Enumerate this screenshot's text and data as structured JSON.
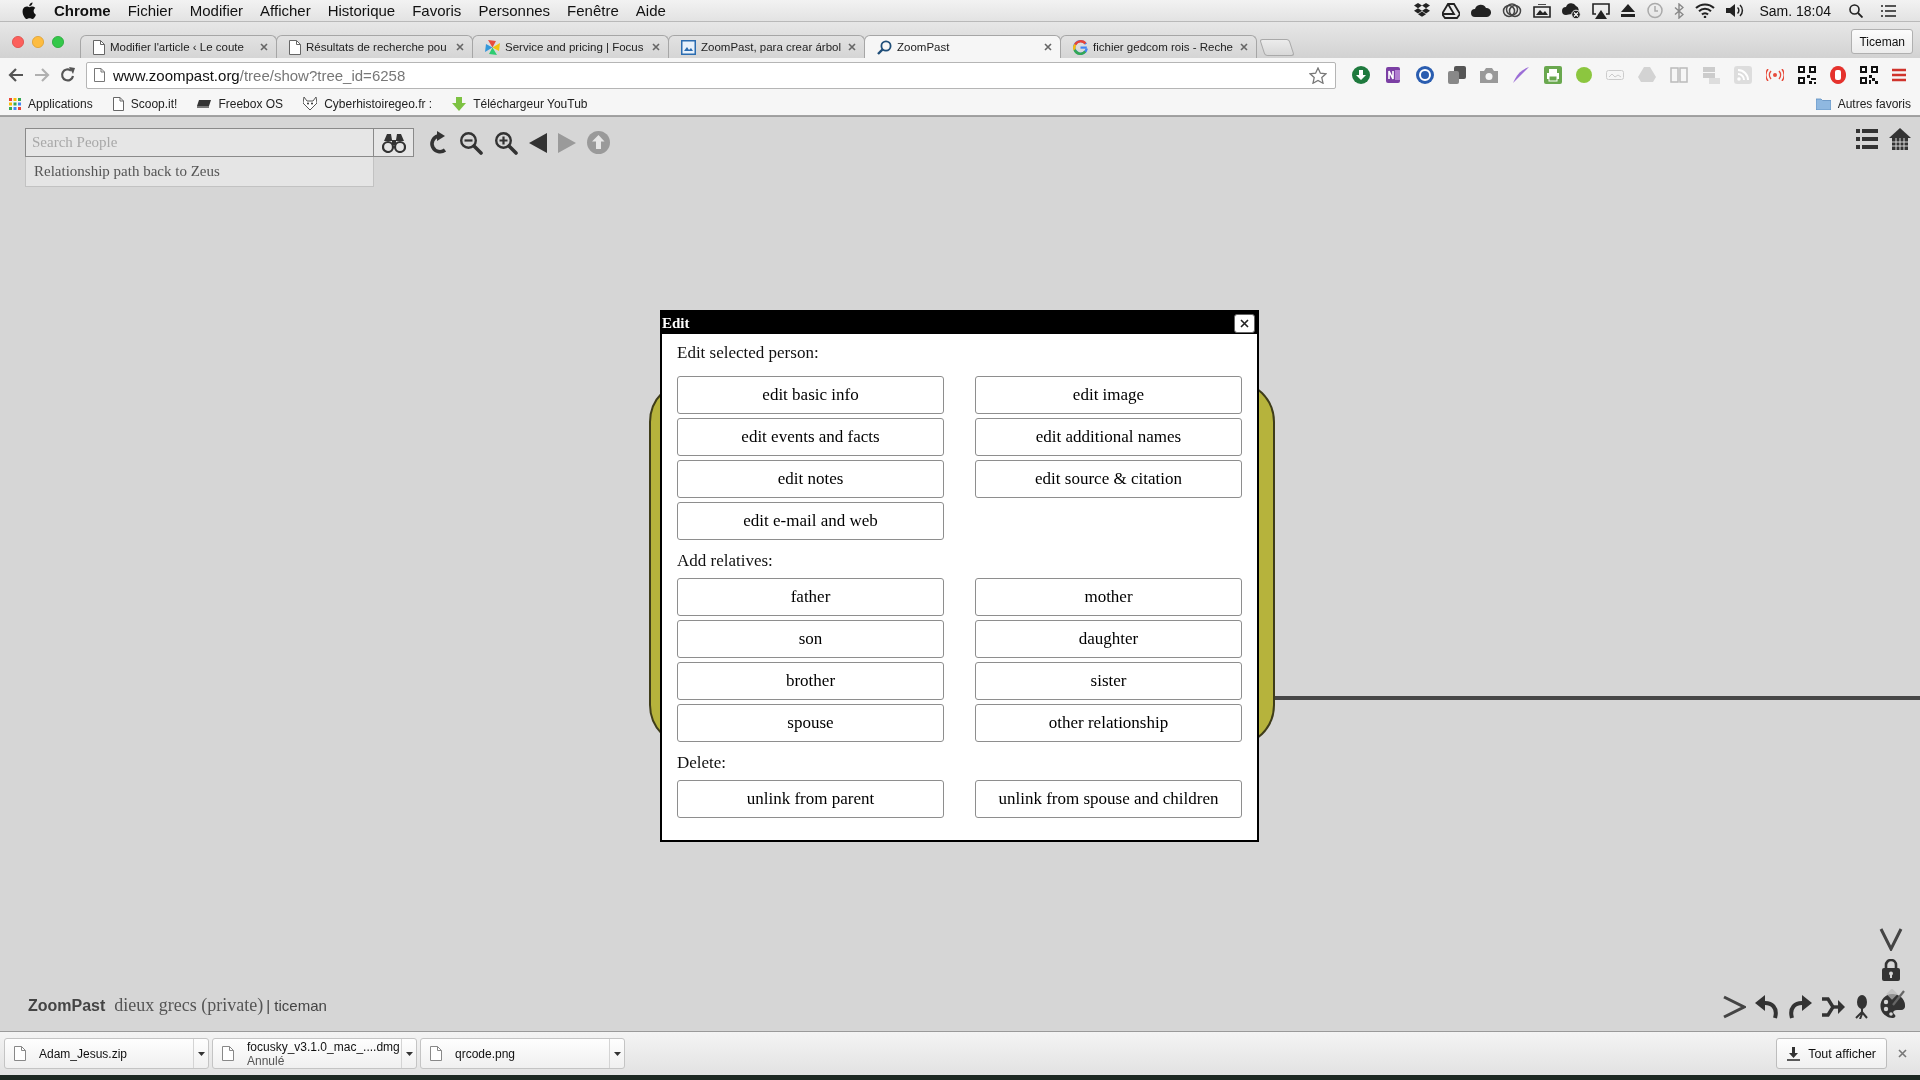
{
  "menu_bar": {
    "app": "Chrome",
    "menus": [
      "Fichier",
      "Modifier",
      "Afficher",
      "Historique",
      "Favoris",
      "Personnes",
      "Fenêtre",
      "Aide"
    ],
    "clock": "Sam. 18:04"
  },
  "browser": {
    "tabs": [
      {
        "title": "Modifier l'article ‹ Le coute",
        "kind": "page",
        "selected": false
      },
      {
        "title": "Résultats de recherche pou",
        "kind": "page",
        "selected": false
      },
      {
        "title": "Service and pricing | Focus",
        "kind": "pinwheel",
        "selected": false
      },
      {
        "title": "ZoomPast, para crear árbol",
        "kind": "picture",
        "selected": false
      },
      {
        "title": "ZoomPast",
        "kind": "magnifier",
        "selected": true
      },
      {
        "title": "fichier gedcom rois - Reche",
        "kind": "google",
        "selected": false
      }
    ],
    "profile": "Ticeman",
    "nav": [
      {
        "kind": "back",
        "disabled": false
      },
      {
        "kind": "forward",
        "disabled": true
      },
      {
        "kind": "reload",
        "disabled": false
      }
    ],
    "address": {
      "domain": "www.zoompast.org",
      "path": "/tree/show?tree_id=6258"
    },
    "bookmarks": [
      {
        "label": "Applications",
        "kind": "apps"
      },
      {
        "label": "Scoop.it!",
        "kind": "page"
      },
      {
        "label": "Freebox OS",
        "kind": "router"
      },
      {
        "label": "Cyberhistoiregeo.fr :",
        "kind": "fox"
      },
      {
        "label": "Téléchargeur YouTub",
        "kind": "download"
      }
    ],
    "other_bookmarks": "Autres favoris"
  },
  "page": {
    "search": {
      "placeholder": "Search People"
    },
    "suggestion": "Relationship path back to Zeus",
    "tools": [
      {
        "kind": "reload",
        "disabled": false
      },
      {
        "kind": "zoom_out",
        "disabled": false
      },
      {
        "kind": "zoom_in",
        "disabled": false
      },
      {
        "kind": "previous",
        "disabled": false
      },
      {
        "kind": "next",
        "disabled": true
      },
      {
        "kind": "up",
        "disabled": true
      }
    ],
    "footer": {
      "brand": "ZoomPast",
      "tree": "dieux grecs (private)",
      "user": "| ticeman"
    }
  },
  "dialog": {
    "title": "Edit",
    "sections": [
      {
        "heading": "Edit selected person:",
        "buttons": [
          "edit basic info",
          "edit image",
          "edit events and facts",
          "edit additional names",
          "edit notes",
          "edit source & citation",
          "edit e-mail and web"
        ]
      },
      {
        "heading": "Add relatives:",
        "buttons": [
          "father",
          "mother",
          "son",
          "daughter",
          "brother",
          "sister",
          "spouse",
          "other relationship"
        ]
      },
      {
        "heading": "Delete:",
        "buttons": [
          "unlink from parent",
          "unlink from spouse and children"
        ]
      }
    ]
  },
  "downloads": {
    "items": [
      {
        "name": "Adam_Jesus.zip"
      },
      {
        "name": "focusky_v3.1.0_mac_....dmg",
        "status": "Annulé"
      },
      {
        "name": "qrcode.png"
      }
    ],
    "show_all": "Tout afficher"
  }
}
